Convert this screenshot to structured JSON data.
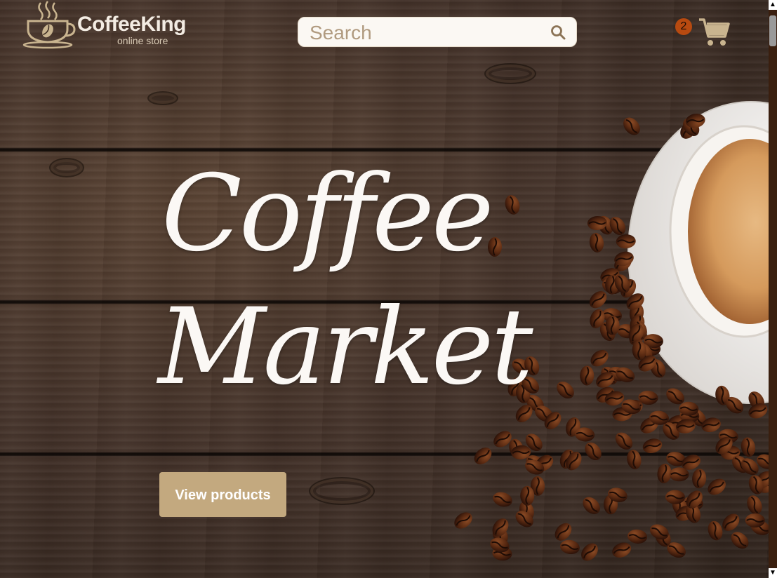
{
  "header": {
    "brand_name": "CoffeeKing",
    "brand_tagline": "online store",
    "search": {
      "placeholder": "Search",
      "value": ""
    },
    "cart": {
      "count": "2"
    }
  },
  "hero": {
    "title_line1": "Coffee",
    "title_line2": "Market",
    "cta_label": "View products"
  },
  "colors": {
    "accent": "#c3a97f",
    "badge": "#b84a10",
    "wood_dark": "#2f231c",
    "text_light": "#fbf8f5"
  },
  "icons": {
    "logo": "coffee-cup-logo-icon",
    "search": "search-icon",
    "cart": "shopping-cart-icon"
  }
}
